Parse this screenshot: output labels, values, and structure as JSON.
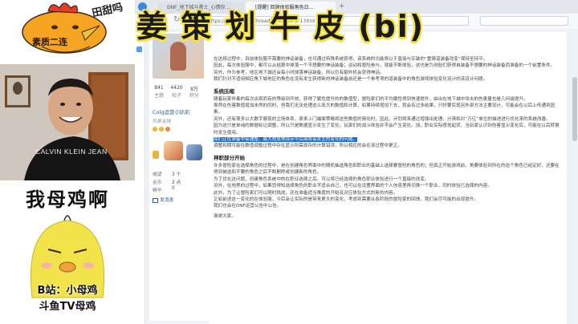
{
  "overlay": {
    "title": "姜 策 划 牛 皮 (bi)"
  },
  "stream": {
    "meme_top_tag": "田甜吗",
    "meme_top_caption": "素质二连",
    "meme_bottom_title": "我母鸡啊",
    "meme_bottom_line1": "B站：小母鸡",
    "meme_bottom_line2": "斗鱼TV母鸡",
    "shirt_text": "CALVIN KLEIN JEAN"
  },
  "browser": {
    "tabs": [
      {
        "label": "DNF_地下城与勇士_心情你…"
      },
      {
        "label": "[提醒] 回顾体验服角色日…"
      }
    ],
    "address": "https://bbs.colg.cn/thread-8165983-1-1.html",
    "search_placeholder": ""
  },
  "user": {
    "name": "Colg运营小叭叭",
    "role": "风暴金锤",
    "stats": [
      {
        "value": "841",
        "label": "主题"
      },
      {
        "value": "4420",
        "label": "帖子"
      },
      {
        "value": "8万",
        "label": "积分"
      }
    ],
    "details": [
      {
        "label": "威望",
        "value": "3 个"
      },
      {
        "label": "金币",
        "value": "2 点"
      },
      {
        "label": "精华",
        "value": "0"
      }
    ],
    "send_message": "发消息"
  },
  "article": {
    "intro": [
      "在这段过程中，目前体验服不需要的神话装备，也可通过特殊系统获得，该系统的功能将以于直接与实装的“重铸道装备改变”保持至持平。",
      "因此，每次体验服中，都可以从结算中掉落一个不想要的神话装备；运动和冒险参与，就能不断体验，这也是为测验们获得自装备不想要的神话装备而准备的一个前置条件。",
      "另外，作为参考，地区地下城还会每小时掉落神话装备，所以仍有额外机会获得神话。",
      "我们针对不适用相应角下城地区的角色在没有发生获得新的神话装备前还是一个参考项的道装备中的角色游戏体验变化设计的该设计问题。"
    ],
    "section1_title": "系统压缩",
    "section1": [
      "随着玩家伴奏的每次出现而有的等级到开放，获得了属性提升的的数值型，冒险家们的平均属性得到快速提升，由出在地下城中攻击的伤害量也是几何级提升。",
      "虽然在伤害数值增加未然的同时，但我们无法处理这么庞大的数值和计算，如果持续增加下去，就会有过多结果，只好要实现另外部方法主要设计，可能会在以后上传通到因素。",
      "另外，还有很多以大数字展现的立场体系，原来上门端面策略将这些数值的简化时，因此，计划将来通过增强出处理，分清和对“万亿”单位的描述进行优化来的系统改善。",
      "因为这只是单纯的数据标记调整，所以只是数据显示发生了变化，玩家们的战斗体验并不会产生变化。加，职业实际感觉起伏，当玩家认识到伤害显示变化后，可能在以后转换时发生使用。",
      "调整和期可能在数值调整过程中存在显示所需现存的计算错误，所以相应的会在该过程中更正。"
    ],
    "highlight": "我们正在准备中会通整、最大程度地保存今后面将会发生的变化的问题。",
    "section2_title": "神职部分开始",
    "section2": [
      "许多冒险家在选择角色的过程中，是在创建角色界面中的随机抽选角色和职业的基础上选择要冒险的角色的；但真正开始游戏前，角要体验到所在的这个角色已经定好，还要在得到被选和不要的角色之后不断删除或创建新的角色。",
      "为了优化这问题，创建角色系统中的在职业选择之后，可以将已经选择的角色职业体验进行一个直接的改变。",
      "另外，在地界的过程中，如果您得知选择角色的职业不适合自己，也可以在设置界面的个人信息里再切换一个职业，同时体验已选择的内容。",
      "此外，为了让冒险家们可以随时挑战，还在准备适当难度的开始及对应体验方式的新的内容。",
      "正如前述这一变化的在体验服，今后会让实际的是带来更大的变化，考虑到需要从各阶段的冒险家的回馈，我们会尽可能的出现提升。",
      "我们也会在DNF运营公告中公告。"
    ],
    "closing": "谢谢大家。"
  }
}
